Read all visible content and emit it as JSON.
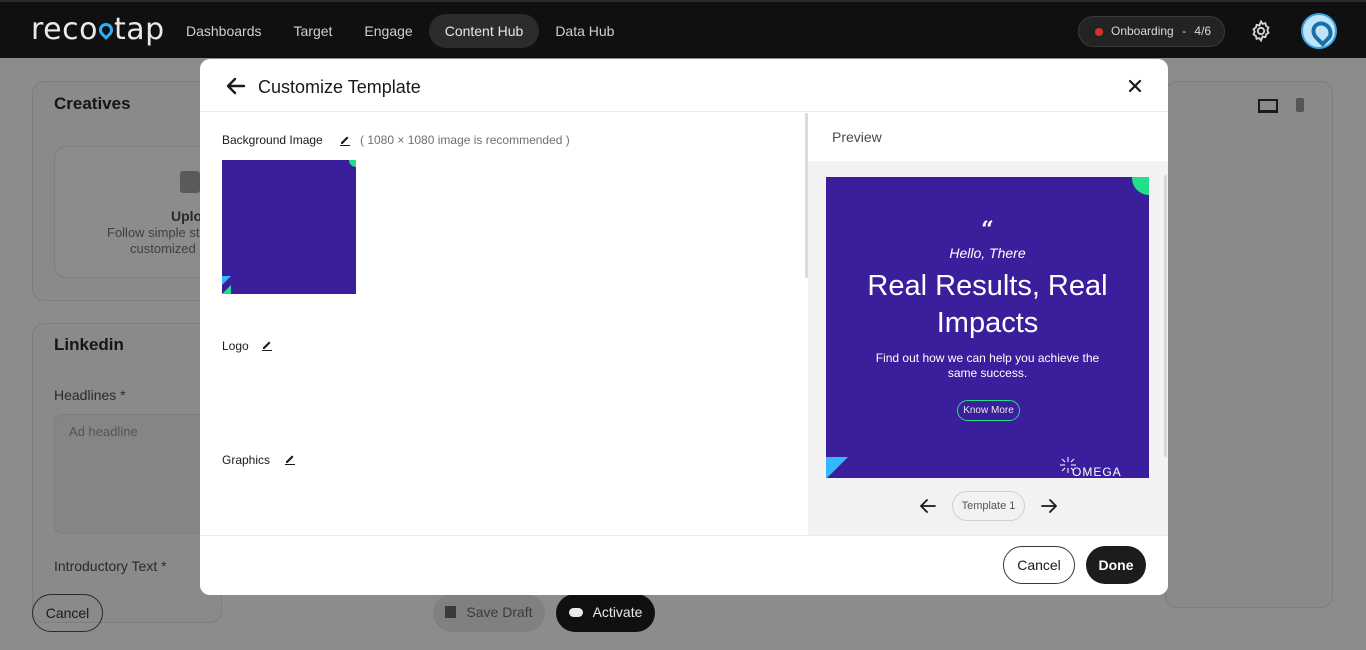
{
  "topbar": {
    "logo": "recotap",
    "nav": [
      "Dashboards",
      "Target",
      "Engage",
      "Content Hub",
      "Data Hub"
    ],
    "active_nav": "Content Hub",
    "onboarding_label": "Onboarding",
    "onboarding_sep": "-",
    "onboarding_progress": "4/6"
  },
  "background_page": {
    "creatives_title": "Creatives",
    "upload_title": "Uplo",
    "upload_desc_1": "Follow simple st",
    "upload_desc_2": "customized",
    "linkedin_title": "Linkedin",
    "headlines_label": "Headlines *",
    "headline_placeholder": "Ad headline",
    "intro_label": "Introductory Text *",
    "cancel": "Cancel",
    "save_draft": "Save Draft",
    "activate": "Activate"
  },
  "modal": {
    "title": "Customize Template",
    "fields": {
      "background_image": "Background Image",
      "background_hint": "( 1080 × 1080 image is recommended )",
      "logo": "Logo",
      "graphics": "Graphics"
    },
    "preview": {
      "label": "Preview",
      "quote_mark": "“",
      "greeting": "Hello, There",
      "headline": "Real Results, Real Impacts",
      "subtext": "Find out how we can help you achieve the same success.",
      "cta": "Know More",
      "brand": "OMEGA",
      "template_name": "Template 1"
    },
    "footer": {
      "cancel": "Cancel",
      "done": "Done"
    }
  },
  "colors": {
    "creative_bg": "#3b1e9b",
    "accent_green": "#22e08a",
    "accent_blue": "#32b8ff",
    "topbar": "#101010"
  }
}
